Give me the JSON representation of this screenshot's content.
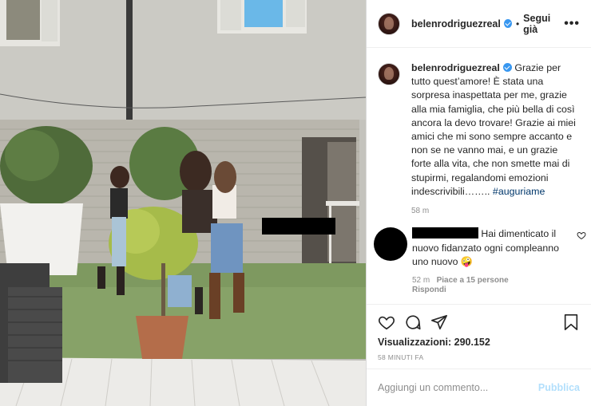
{
  "post": {
    "author": "belenrodriguezreal",
    "verified": true,
    "follow_label": "Segui già",
    "separator": "•",
    "more_label": "•••"
  },
  "caption": {
    "username": "belenrodriguezreal",
    "text": "Grazie per tutto quest’amore! È stata una sorpresa inaspettata per me, grazie alla mia famiglia, che più bella di così ancora la devo trovare! Grazie ai miei amici che mi sono sempre accanto e non se ne vanno mai, e un grazie forte alla vita, che non smette mai di stupirmi, regalandomi emozioni indescrivibili……..",
    "hashtag": "#auguriame",
    "time": "58 m"
  },
  "comment": {
    "text": "Hai dimenticato il nuovo fidanzato ogni compleanno uno nuovo 🤪",
    "time": "52 m",
    "likes": "Piace a 15 persone",
    "reply_label": "Rispondi"
  },
  "stats": {
    "views_label": "Visualizzazioni:",
    "views_value": "290.152",
    "posted_ago": "58 MINUTI FA"
  },
  "composer": {
    "placeholder": "Aggiungi un commento...",
    "publish_label": "Pubblica"
  },
  "icons": {
    "like": "heart-icon",
    "comment": "comment-icon",
    "share": "share-icon",
    "save": "bookmark-icon"
  },
  "colors": {
    "link": "#00376b",
    "verified": "#3897f0",
    "muted": "#8e8e8e",
    "publish_disabled": "#b2dffc"
  }
}
